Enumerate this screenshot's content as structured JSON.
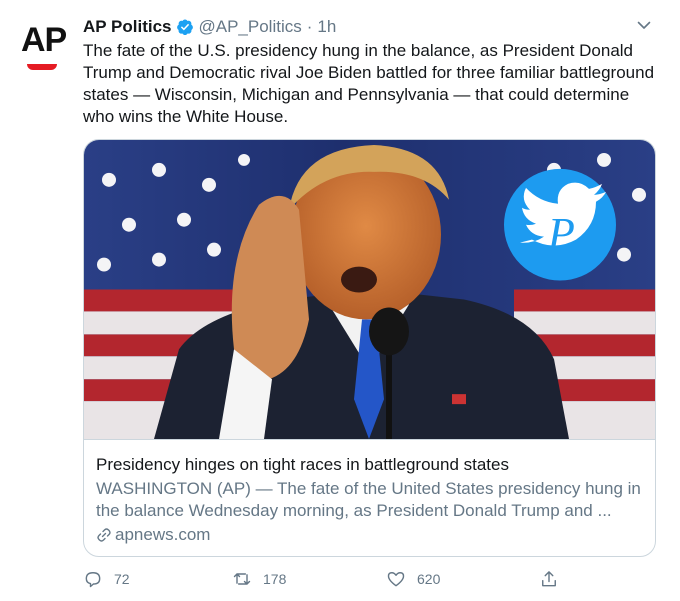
{
  "tweet": {
    "display_name": "AP Politics",
    "handle": "@AP_Politics",
    "separator": "·",
    "timestamp": "1h",
    "text": "The fate of the U.S. presidency hung in the balance, as President Donald Trump and Democratic rival Joe Biden battled for three familiar battleground states — Wisconsin, Michigan and Pennsylvania — that could determine who wins the White House.",
    "avatar_text": "AP"
  },
  "card": {
    "title": "Presidency hinges on tight races in battleground states",
    "description": "WASHINGTON (AP) — The fate of the United States presidency hung in the balance Wednesday morning, as President Donald Trump and ...",
    "domain": "apnews.com",
    "watermark_letter": "P"
  },
  "actions": {
    "replies": "72",
    "retweets": "178",
    "likes": "620"
  },
  "colors": {
    "verified": "#1da1f2",
    "secondary_text": "#657786",
    "ap_red": "#e51b23",
    "border": "#ccd6dd"
  },
  "icons": [
    "verified-icon",
    "chevron-down-icon",
    "link-icon",
    "reply-icon",
    "retweet-icon",
    "like-icon",
    "share-icon",
    "twitter-bird-icon"
  ]
}
